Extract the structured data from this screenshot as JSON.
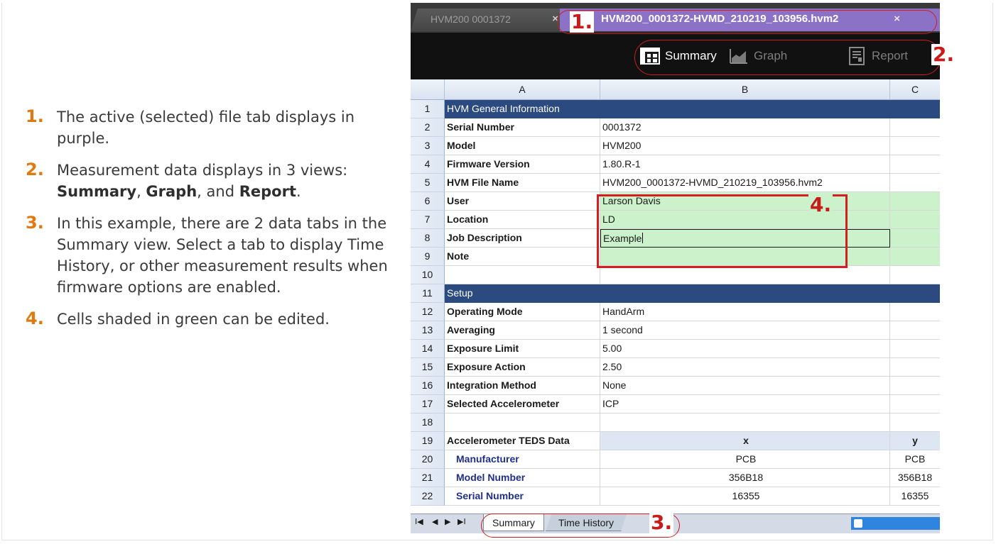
{
  "notes": [
    {
      "num": "1.",
      "text": "The active (selected) file tab displays in purple."
    },
    {
      "num": "2.",
      "pre": "Measurement data displays in 3 views: ",
      "v1": "Summary",
      "sep1": ", ",
      "v2": "Graph",
      "sep2": ", and ",
      "v3": "Report",
      "post": "."
    },
    {
      "num": "3.",
      "text": "In this example, there are 2 data tabs in the Summary view. Select a tab to display Time History, or other measurement results when firmware options are enabled."
    },
    {
      "num": "4.",
      "text": "Cells shaded in green can be edited."
    }
  ],
  "file_tabs": {
    "inactive_label": "HVM200 0001372",
    "active_label": "HVM200_0001372-HVMD_210219_103956.hvm2",
    "close_glyph": "×",
    "active_color": "#8b72c6"
  },
  "toolbar": {
    "summary_label": "Summary",
    "graph_label": "Graph",
    "report_label": "Report"
  },
  "columns": [
    "A",
    "B",
    "C"
  ],
  "rows": [
    {
      "n": "1",
      "a": "HVM General Information",
      "b": "",
      "c": ""
    },
    {
      "n": "2",
      "a": "Serial Number",
      "b": "0001372",
      "c": ""
    },
    {
      "n": "3",
      "a": "Model",
      "b": "HVM200",
      "c": ""
    },
    {
      "n": "4",
      "a": "Firmware Version",
      "b": "1.80.R-1",
      "c": ""
    },
    {
      "n": "5",
      "a": "HVM File Name",
      "b": "HVM200_0001372-HVMD_210219_103956.hvm2",
      "c": ""
    },
    {
      "n": "6",
      "a": "User",
      "b": "Larson Davis",
      "c": ""
    },
    {
      "n": "7",
      "a": "Location",
      "b": "LD",
      "c": ""
    },
    {
      "n": "8",
      "a": "Job Description",
      "b": "Example",
      "c": ""
    },
    {
      "n": "9",
      "a": "Note",
      "b": "",
      "c": ""
    },
    {
      "n": "10",
      "a": "",
      "b": "",
      "c": ""
    },
    {
      "n": "11",
      "a": "Setup",
      "b": "",
      "c": ""
    },
    {
      "n": "12",
      "a": "Operating Mode",
      "b": "HandArm",
      "c": ""
    },
    {
      "n": "13",
      "a": "Averaging",
      "b": "1 second",
      "c": ""
    },
    {
      "n": "14",
      "a": "Exposure Limit",
      "b": "5.00",
      "c": ""
    },
    {
      "n": "15",
      "a": "Exposure Action",
      "b": "2.50",
      "c": ""
    },
    {
      "n": "16",
      "a": "Integration Method",
      "b": "None",
      "c": ""
    },
    {
      "n": "17",
      "a": "Selected Accelerometer",
      "b": "ICP",
      "c": ""
    },
    {
      "n": "18",
      "a": "",
      "b": "",
      "c": ""
    },
    {
      "n": "19",
      "a": "Accelerometer TEDS Data",
      "b": "x",
      "c": "y"
    },
    {
      "n": "20",
      "a": "Manufacturer",
      "b": "PCB",
      "c": "PCB"
    },
    {
      "n": "21",
      "a": "Model Number",
      "b": "356B18",
      "c": "356B18"
    },
    {
      "n": "22",
      "a": "Serial Number",
      "b": "16355",
      "c": "16355"
    }
  ],
  "sheet_tabs": {
    "nav": [
      "I◀",
      "◀",
      "▶",
      "▶I"
    ],
    "active": "Summary",
    "other": "Time History"
  },
  "callouts": {
    "c1": "1.",
    "c2": "2.",
    "c3": "3.",
    "c4": "4."
  },
  "colors": {
    "note_number": "#e07a10",
    "section_header": "#2b4b80",
    "editable_cell": "#ccf2cc",
    "callout": "#cc1e1e"
  }
}
